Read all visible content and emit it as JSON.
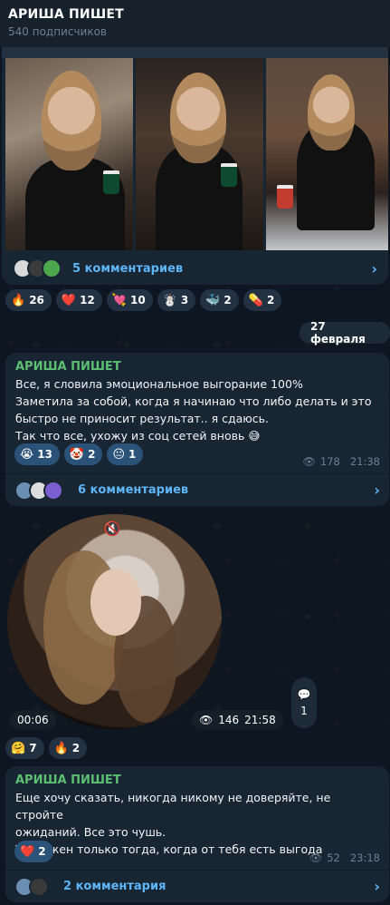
{
  "channel": {
    "title": "АРИША ПИШЕТ",
    "subscribers": "540 подписчиков"
  },
  "album": {
    "comments_label": "5 комментариев",
    "reactions": [
      {
        "emoji": "🔥",
        "count": "26"
      },
      {
        "emoji": "❤️",
        "count": "12"
      },
      {
        "emoji": "💘",
        "count": "10"
      },
      {
        "emoji": "☃️",
        "count": "3"
      },
      {
        "emoji": "🐳",
        "count": "2"
      },
      {
        "emoji": "💊",
        "count": "2"
      }
    ]
  },
  "date_divider": "27 февраля",
  "post1": {
    "author": "АРИША ПИШЕТ",
    "lines": [
      "Все, я словила эмоциональное выгорание 100%",
      "Заметила за собой, когда я начинаю что либо делать и это",
      "быстро не приносит результат.. я сдаюсь.",
      "Так что все, ухожу из соц сетей вновь 😅"
    ],
    "reactions": [
      {
        "emoji": "😭",
        "count": "13"
      },
      {
        "emoji": "🤡",
        "count": "2"
      },
      {
        "emoji": "😐",
        "count": "1"
      }
    ],
    "views": "178",
    "time": "21:38",
    "comments_label": "6 комментариев"
  },
  "video": {
    "duration": "00:06",
    "views": "146",
    "time": "21:58",
    "reply_count": "1",
    "reactions": [
      {
        "emoji": "🤗",
        "count": "7"
      },
      {
        "emoji": "🔥",
        "count": "2"
      }
    ]
  },
  "post2": {
    "author": "АРИША ПИШЕТ",
    "lines": [
      "Еще хочу сказать, никогда никому не доверяйте, не стройте",
      "ожиданий. Все это чушь.",
      "Ты нужен только тогда, когда от тебя есть выгода"
    ],
    "reactions": [
      {
        "emoji": "❤️",
        "count": "2"
      }
    ],
    "views": "52",
    "time": "23:18",
    "comments_label": "2 комментария"
  },
  "icons": {
    "eye": "eye-icon",
    "chevron": "chevron-right-icon",
    "mute": "mute-icon",
    "comment": "comment-bubble-icon"
  },
  "colors": {
    "background": "#0e1621",
    "bubble": "#182533",
    "accent_link": "#5eb5f7",
    "author": "#5dbf71"
  }
}
